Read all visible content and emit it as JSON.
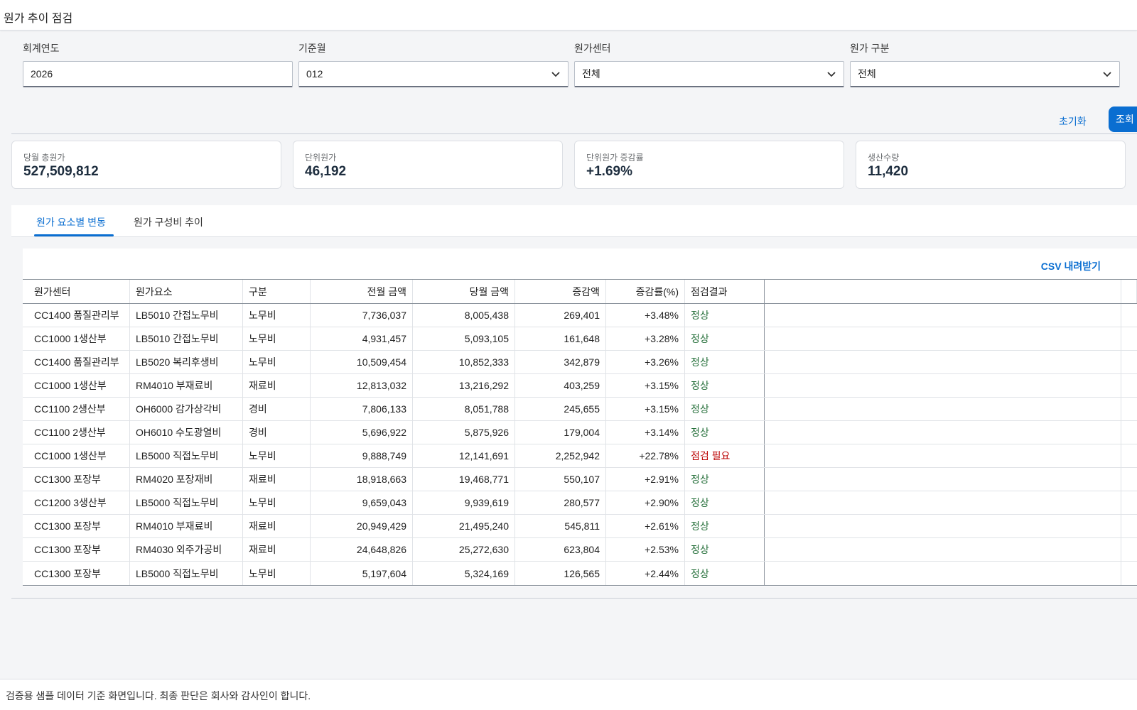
{
  "header": {
    "title": "원가 추이 점검"
  },
  "filters": [
    {
      "label": "회계연도",
      "value": "2026",
      "dropdown": false
    },
    {
      "label": "기준월",
      "value": "012",
      "dropdown": true
    },
    {
      "label": "원가센터",
      "value": "전체",
      "dropdown": true
    },
    {
      "label": "원가 구분",
      "value": "전체",
      "dropdown": true
    }
  ],
  "actions": {
    "reset_label": "초기화",
    "search_label": "조회"
  },
  "kpis": [
    {
      "label": "당월 총원가",
      "value": "527,509,812"
    },
    {
      "label": "단위원가",
      "value": "46,192"
    },
    {
      "label": "단위원가 증감률",
      "value": "+1.69%"
    },
    {
      "label": "생산수량",
      "value": "11,420"
    }
  ],
  "tabs": [
    {
      "label": "원가 요소별 변동",
      "active": true
    },
    {
      "label": "원가 구성비 추이",
      "active": false
    }
  ],
  "table": {
    "csv_label": "CSV 내려받기",
    "columns": [
      "원가센터",
      "원가요소",
      "구분",
      "전월 금액",
      "당월 금액",
      "증감액",
      "증감률(%)",
      "점검결과"
    ],
    "rows": [
      [
        "CC1400 품질관리부",
        "LB5010 간접노무비",
        "노무비",
        "7,736,037",
        "8,005,438",
        "269,401",
        "+3.48%",
        "정상"
      ],
      [
        "CC1000 1생산부",
        "LB5010 간접노무비",
        "노무비",
        "4,931,457",
        "5,093,105",
        "161,648",
        "+3.28%",
        "정상"
      ],
      [
        "CC1400 품질관리부",
        "LB5020 복리후생비",
        "노무비",
        "10,509,454",
        "10,852,333",
        "342,879",
        "+3.26%",
        "정상"
      ],
      [
        "CC1000 1생산부",
        "RM4010 부재료비",
        "재료비",
        "12,813,032",
        "13,216,292",
        "403,259",
        "+3.15%",
        "정상"
      ],
      [
        "CC1100 2생산부",
        "OH6000 감가상각비",
        "경비",
        "7,806,133",
        "8,051,788",
        "245,655",
        "+3.15%",
        "정상"
      ],
      [
        "CC1100 2생산부",
        "OH6010 수도광열비",
        "경비",
        "5,696,922",
        "5,875,926",
        "179,004",
        "+3.14%",
        "정상"
      ],
      [
        "CC1000 1생산부",
        "LB5000 직접노무비",
        "노무비",
        "9,888,749",
        "12,141,691",
        "2,252,942",
        "+22.78%",
        "점검 필요"
      ],
      [
        "CC1300 포장부",
        "RM4020 포장재비",
        "재료비",
        "18,918,663",
        "19,468,771",
        "550,107",
        "+2.91%",
        "정상"
      ],
      [
        "CC1200 3생산부",
        "LB5000 직접노무비",
        "노무비",
        "9,659,043",
        "9,939,619",
        "280,577",
        "+2.90%",
        "정상"
      ],
      [
        "CC1300 포장부",
        "RM4010 부재료비",
        "재료비",
        "20,949,429",
        "21,495,240",
        "545,811",
        "+2.61%",
        "정상"
      ],
      [
        "CC1300 포장부",
        "RM4030 외주가공비",
        "재료비",
        "24,648,826",
        "25,272,630",
        "623,804",
        "+2.53%",
        "정상"
      ],
      [
        "CC1300 포장부",
        "LB5000 직접노무비",
        "노무비",
        "5,197,604",
        "5,324,169",
        "126,565",
        "+2.44%",
        "정상"
      ]
    ]
  },
  "footer": {
    "note": "검증용 샘플 데이터 기준 화면입니다. 최종 판단은 회사와 감사인이 합니다."
  }
}
